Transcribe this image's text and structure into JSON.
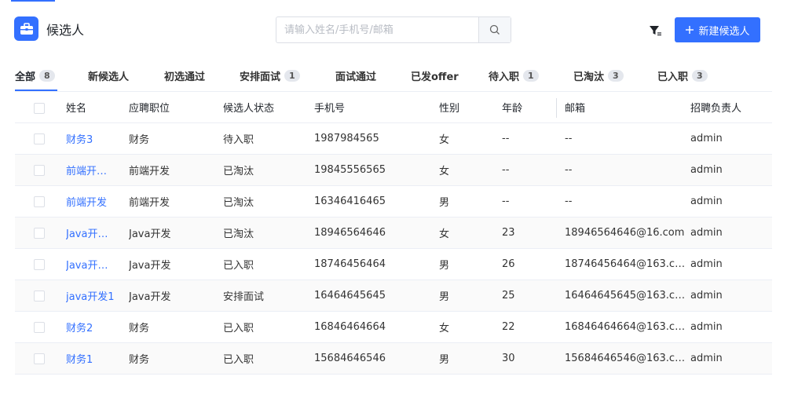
{
  "header": {
    "title": "候选人",
    "title_icon": "briefcase-icon",
    "search_placeholder": "请输入姓名/手机号/邮箱",
    "new_button_label": "新建候选人",
    "accent_color": "#3370ff"
  },
  "tabs": [
    {
      "label": "全部",
      "count": "8",
      "active": true
    },
    {
      "label": "新候选人",
      "count": ""
    },
    {
      "label": "初选通过",
      "count": ""
    },
    {
      "label": "安排面试",
      "count": "1"
    },
    {
      "label": "面试通过",
      "count": ""
    },
    {
      "label": "已发offer",
      "count": ""
    },
    {
      "label": "待入职",
      "count": "1"
    },
    {
      "label": "已淘汰",
      "count": "3"
    },
    {
      "label": "已入职",
      "count": "3"
    }
  ],
  "table": {
    "columns": [
      "姓名",
      "应聘职位",
      "候选人状态",
      "手机号",
      "性别",
      "年龄",
      "邮箱",
      "招聘负责人"
    ],
    "rows": [
      [
        "财务3",
        "财务",
        "待入职",
        "1987984565",
        "女",
        "--",
        "--",
        "admin"
      ],
      [
        "前端开…",
        "前端开发",
        "已淘汰",
        "19845556565",
        "女",
        "--",
        "--",
        "admin"
      ],
      [
        "前端开发",
        "前端开发",
        "已淘汰",
        "16346416465",
        "男",
        "--",
        "--",
        "admin"
      ],
      [
        "Java开…",
        "Java开发",
        "已淘汰",
        "18946564646",
        "女",
        "23",
        "18946564646@16.com",
        "admin"
      ],
      [
        "Java开…",
        "Java开发",
        "已入职",
        "18746456464",
        "男",
        "26",
        "18746456464@163.c…",
        "admin"
      ],
      [
        "java开发1",
        "Java开发",
        "安排面试",
        "16464645645",
        "男",
        "25",
        "16464645645@163.c…",
        "admin"
      ],
      [
        "财务2",
        "财务",
        "已入职",
        "16846464664",
        "女",
        "22",
        "16846464664@163.c…",
        "admin"
      ],
      [
        "财务1",
        "财务",
        "已入职",
        "15684646546",
        "男",
        "30",
        "15684646546@163.c…",
        "admin"
      ]
    ]
  }
}
